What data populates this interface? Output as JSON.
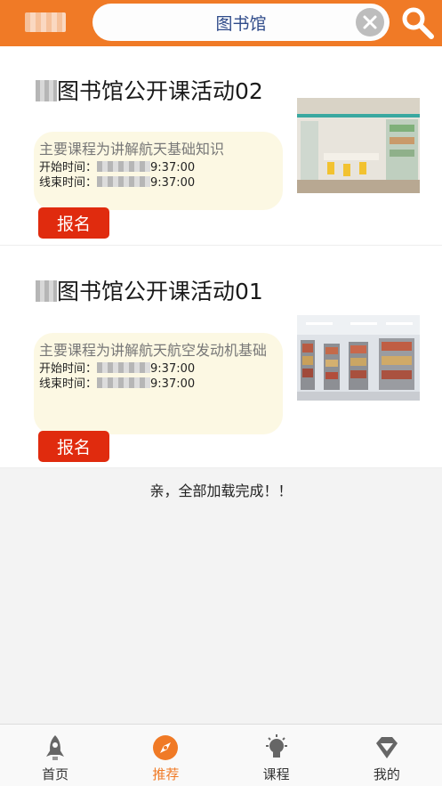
{
  "header": {
    "city": "",
    "search_text": "图书馆",
    "accent": "#f07a26"
  },
  "cards": [
    {
      "title_suffix": "图书馆公开课活动02",
      "description": "主要课程为讲解航天基础知识",
      "start_label": "开始时间：",
      "start_time": "9:37:00",
      "end_label": "线束时间：",
      "end_time": "9:37:00",
      "button": "报名"
    },
    {
      "title_suffix": "图书馆公开课活动01",
      "description": "主要课程为讲解航天航空发动机基础",
      "start_label": "开始时间：",
      "start_time": "9:37:00",
      "end_label": "线束时间：",
      "end_time": "9:37:00",
      "button": "报名"
    }
  ],
  "load_complete": "亲，全部加载完成！！",
  "nav": [
    {
      "label": "首页",
      "icon": "rocket-icon",
      "active": false
    },
    {
      "label": "推荐",
      "icon": "compass-icon",
      "active": true
    },
    {
      "label": "课程",
      "icon": "lightbulb-icon",
      "active": false
    },
    {
      "label": "我的",
      "icon": "diamond-icon",
      "active": false
    }
  ]
}
